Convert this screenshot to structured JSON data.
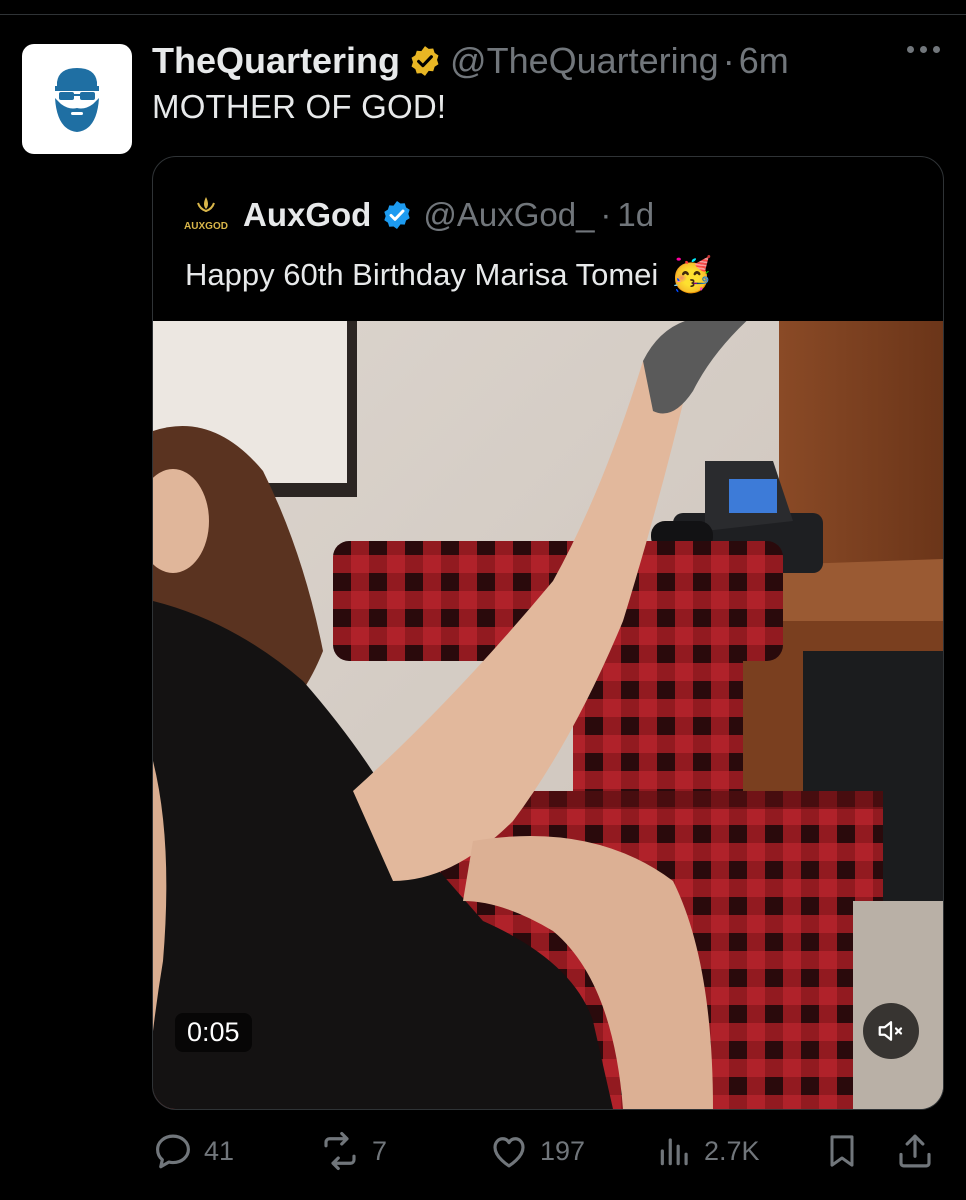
{
  "post": {
    "author_name": "TheQuartering",
    "author_handle": "@TheQuartering",
    "separator": "·",
    "time": "6m",
    "text": "MOTHER OF GOD!"
  },
  "quote": {
    "author_name": "AuxGod",
    "author_handle": "@AuxGod_",
    "separator": "·",
    "time": "1d",
    "logo_text": "AUXGOD",
    "text": "Happy 60th Birthday Marisa Tomei",
    "emoji": "🥳",
    "video": {
      "duration": "0:05",
      "muted": true
    }
  },
  "actions": {
    "replies": "41",
    "reposts": "7",
    "likes": "197",
    "views": "2.7K"
  },
  "colors": {
    "background": "#000000",
    "text_primary": "#e7e9ea",
    "text_secondary": "#71767b",
    "verified_gold": "#e8b624",
    "verified_blue": "#1d9bf0",
    "border": "#2f3336"
  },
  "icons": {
    "more": "more-dots-icon",
    "verified_gold": "verified-gold-icon",
    "verified_blue": "verified-blue-icon",
    "reply": "reply-icon",
    "repost": "repost-icon",
    "like": "like-icon",
    "views": "views-icon",
    "bookmark": "bookmark-icon",
    "share": "share-icon",
    "mute": "muted-speaker-icon"
  }
}
